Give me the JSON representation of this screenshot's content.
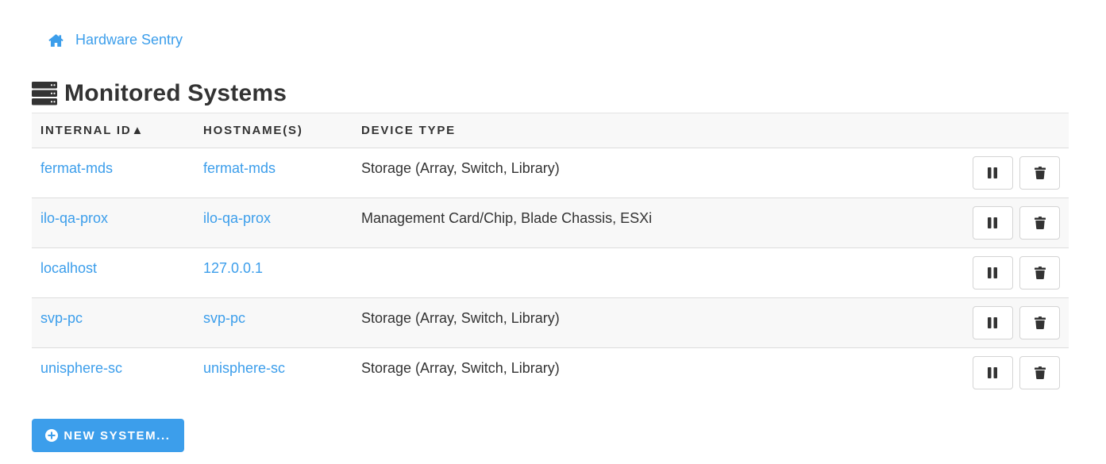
{
  "breadcrumb": {
    "icon": "home-icon",
    "label": "Hardware Sentry"
  },
  "page": {
    "title_icon": "server-stack-icon",
    "title": "Monitored Systems"
  },
  "table": {
    "columns": [
      {
        "label": "INTERNAL ID▲",
        "sorted": "ascending"
      },
      {
        "label": "HOSTNAME(S)"
      },
      {
        "label": "DEVICE TYPE"
      }
    ],
    "rows": [
      {
        "id": "fermat-mds",
        "hostname": "fermat-mds",
        "device_type": "Storage (Array, Switch, Library)"
      },
      {
        "id": "ilo-qa-prox",
        "hostname": "ilo-qa-prox",
        "device_type": "Management Card/Chip, Blade Chassis, ESXi"
      },
      {
        "id": "localhost",
        "hostname": "127.0.0.1",
        "device_type": ""
      },
      {
        "id": "svp-pc",
        "hostname": "svp-pc",
        "device_type": "Storage (Array, Switch, Library)"
      },
      {
        "id": "unisphere-sc",
        "hostname": "unisphere-sc",
        "device_type": "Storage (Array, Switch, Library)"
      }
    ],
    "row_actions": [
      {
        "icon": "pause-icon"
      },
      {
        "icon": "trash-icon"
      }
    ]
  },
  "actions": {
    "new_system_icon": "plus-circle-icon",
    "new_system_label": "NEW SYSTEM..."
  },
  "colors": {
    "accent": "#3c9eeb",
    "text": "#333333",
    "stripe": "#f8f8f8",
    "border": "#dddddd"
  }
}
